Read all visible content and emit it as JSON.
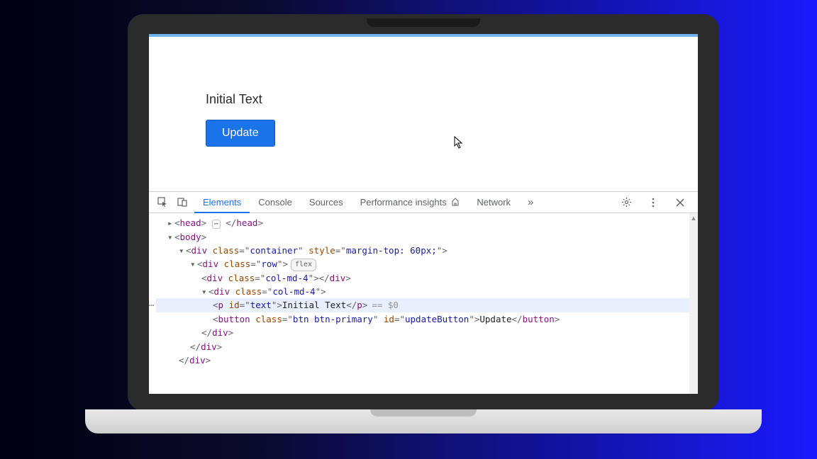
{
  "page": {
    "text_label": "Initial Text",
    "update_button_label": "Update"
  },
  "devtools": {
    "tabs": {
      "elements": "Elements",
      "console": "Console",
      "sources": "Sources",
      "perf_insights": "Performance insights",
      "network": "Network"
    },
    "overflow_glyph": "»",
    "html": {
      "head_collapsed": "<head> ⋯ </head>",
      "body_open": "body",
      "container_tag": "div",
      "container_class": "class",
      "container_class_val": "container",
      "container_style": "style",
      "container_style_val": "margin-top: 60px;",
      "row_tag": "div",
      "row_class_val": "row",
      "flex_badge": "flex",
      "col1_tag": "div",
      "col1_class_val": "col-md-4",
      "col2_tag": "div",
      "col2_class_val": "col-md-4",
      "p_tag": "p",
      "p_id_attr": "id",
      "p_id_val": "text",
      "p_text": "Initial Text",
      "eq_sel": "== $0",
      "button_tag": "button",
      "button_class_val": "btn btn-primary",
      "button_id_val": "updateButton",
      "button_text": "Update",
      "div_close": "div"
    }
  }
}
